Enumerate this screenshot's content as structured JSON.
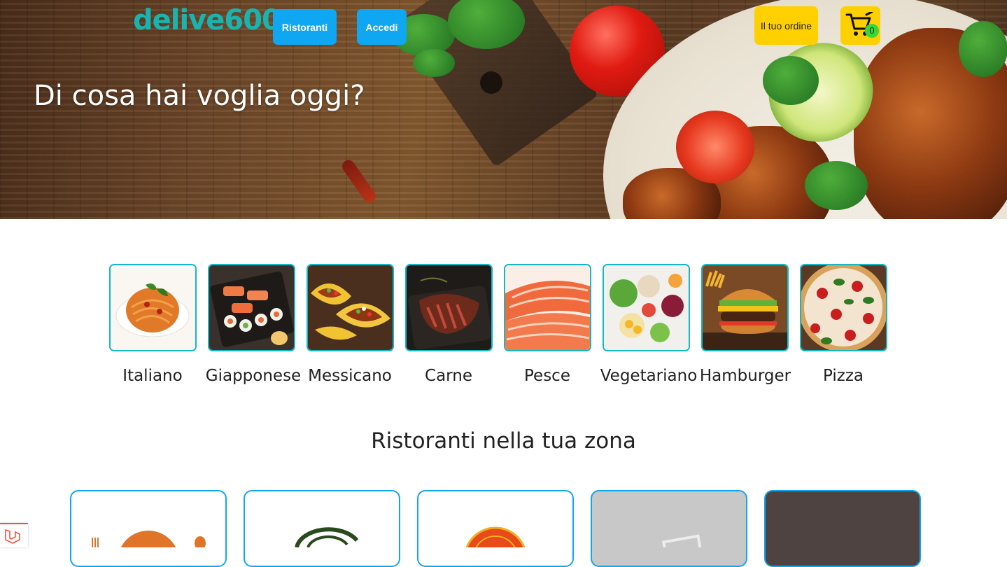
{
  "brand": {
    "logo_text": "delive600"
  },
  "nav": {
    "restaurants_label": "Ristoranti",
    "login_label": "Accedi",
    "order_label": "Il tuo ordine",
    "cart_count": "0"
  },
  "hero": {
    "title": "Di cosa hai voglia oggi?"
  },
  "categories": [
    {
      "label": "Italiano"
    },
    {
      "label": "Giapponese"
    },
    {
      "label": "Messicano"
    },
    {
      "label": "Carne"
    },
    {
      "label": "Pesce"
    },
    {
      "label": "Vegetariano"
    },
    {
      "label": "Hamburger"
    },
    {
      "label": "Pizza"
    }
  ],
  "restaurants": {
    "title": "Ristoranti nella tua zona"
  },
  "colors": {
    "brand": "#19b4b0",
    "primary_button": "#0fa7f2",
    "order_button": "#ffd000",
    "category_border": "#13b8c2",
    "cart_badge": "#3fd43a"
  },
  "icons": {
    "cart": "cart-icon",
    "laravel": "laravel-icon"
  }
}
